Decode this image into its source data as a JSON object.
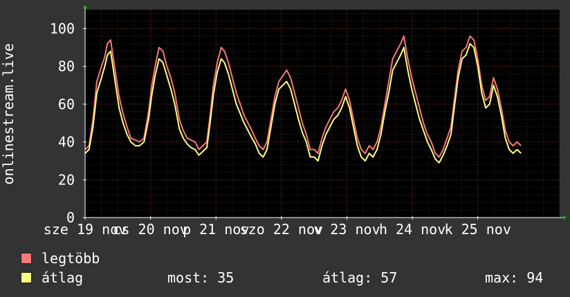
{
  "chart_data": {
    "type": "line",
    "ylabel": "onlinestream.live",
    "ylim": [
      0,
      110
    ],
    "yticks": [
      0,
      20,
      40,
      60,
      80,
      100
    ],
    "xlim": [
      0,
      7.25
    ],
    "xticks": [
      {
        "x": 0,
        "label": "sze 19 nov"
      },
      {
        "x": 1,
        "label": "cs 20 nov"
      },
      {
        "x": 2,
        "label": "p 21 nov"
      },
      {
        "x": 3,
        "label": "szo 22 nov"
      },
      {
        "x": 4,
        "label": "v 23 nov"
      },
      {
        "x": 5,
        "label": "h 24 nov"
      },
      {
        "x": 6,
        "label": "k 25 nov"
      }
    ],
    "grid": true,
    "series": [
      {
        "name": "legtöbb",
        "color": "#f87979",
        "points": [
          [
            0.0,
            36
          ],
          [
            0.06,
            38
          ],
          [
            0.12,
            52
          ],
          [
            0.18,
            72
          ],
          [
            0.25,
            80
          ],
          [
            0.3,
            85
          ],
          [
            0.34,
            92
          ],
          [
            0.39,
            94
          ],
          [
            0.45,
            80
          ],
          [
            0.52,
            64
          ],
          [
            0.58,
            55
          ],
          [
            0.64,
            48
          ],
          [
            0.7,
            42
          ],
          [
            0.77,
            41
          ],
          [
            0.83,
            40
          ],
          [
            0.9,
            42
          ],
          [
            0.97,
            56
          ],
          [
            1.02,
            70
          ],
          [
            1.07,
            80
          ],
          [
            1.13,
            90
          ],
          [
            1.19,
            88
          ],
          [
            1.25,
            80
          ],
          [
            1.31,
            74
          ],
          [
            1.37,
            66
          ],
          [
            1.44,
            52
          ],
          [
            1.5,
            46
          ],
          [
            1.56,
            42
          ],
          [
            1.62,
            41
          ],
          [
            1.68,
            40
          ],
          [
            1.74,
            36
          ],
          [
            1.8,
            38
          ],
          [
            1.86,
            40
          ],
          [
            1.91,
            54
          ],
          [
            1.96,
            70
          ],
          [
            2.02,
            82
          ],
          [
            2.08,
            90
          ],
          [
            2.13,
            88
          ],
          [
            2.19,
            82
          ],
          [
            2.25,
            74
          ],
          [
            2.31,
            66
          ],
          [
            2.37,
            60
          ],
          [
            2.43,
            54
          ],
          [
            2.49,
            50
          ],
          [
            2.55,
            46
          ],
          [
            2.6,
            42
          ],
          [
            2.66,
            38
          ],
          [
            2.72,
            36
          ],
          [
            2.78,
            40
          ],
          [
            2.84,
            52
          ],
          [
            2.9,
            64
          ],
          [
            2.96,
            72
          ],
          [
            3.02,
            75
          ],
          [
            3.08,
            78
          ],
          [
            3.14,
            74
          ],
          [
            3.2,
            66
          ],
          [
            3.26,
            58
          ],
          [
            3.32,
            50
          ],
          [
            3.38,
            44
          ],
          [
            3.44,
            36
          ],
          [
            3.5,
            36
          ],
          [
            3.56,
            34
          ],
          [
            3.62,
            42
          ],
          [
            3.68,
            48
          ],
          [
            3.74,
            52
          ],
          [
            3.8,
            56
          ],
          [
            3.86,
            58
          ],
          [
            3.92,
            62
          ],
          [
            3.98,
            68
          ],
          [
            4.04,
            62
          ],
          [
            4.1,
            52
          ],
          [
            4.16,
            42
          ],
          [
            4.22,
            36
          ],
          [
            4.28,
            34
          ],
          [
            4.34,
            38
          ],
          [
            4.4,
            36
          ],
          [
            4.46,
            40
          ],
          [
            4.52,
            48
          ],
          [
            4.58,
            60
          ],
          [
            4.64,
            72
          ],
          [
            4.7,
            84
          ],
          [
            4.76,
            88
          ],
          [
            4.82,
            92
          ],
          [
            4.87,
            96
          ],
          [
            4.93,
            84
          ],
          [
            4.99,
            74
          ],
          [
            5.05,
            66
          ],
          [
            5.11,
            58
          ],
          [
            5.17,
            50
          ],
          [
            5.23,
            44
          ],
          [
            5.29,
            40
          ],
          [
            5.35,
            34
          ],
          [
            5.41,
            32
          ],
          [
            5.47,
            36
          ],
          [
            5.53,
            42
          ],
          [
            5.59,
            48
          ],
          [
            5.64,
            62
          ],
          [
            5.7,
            78
          ],
          [
            5.76,
            88
          ],
          [
            5.82,
            90
          ],
          [
            5.88,
            96
          ],
          [
            5.94,
            94
          ],
          [
            6.0,
            84
          ],
          [
            6.06,
            70
          ],
          [
            6.12,
            62
          ],
          [
            6.18,
            64
          ],
          [
            6.24,
            74
          ],
          [
            6.3,
            68
          ],
          [
            6.36,
            58
          ],
          [
            6.42,
            46
          ],
          [
            6.48,
            40
          ],
          [
            6.54,
            38
          ],
          [
            6.6,
            40
          ],
          [
            6.66,
            38
          ]
        ]
      },
      {
        "name": "átlag",
        "color": "#ffff80",
        "points": [
          [
            0.0,
            34
          ],
          [
            0.06,
            36
          ],
          [
            0.12,
            48
          ],
          [
            0.18,
            66
          ],
          [
            0.25,
            74
          ],
          [
            0.3,
            80
          ],
          [
            0.34,
            86
          ],
          [
            0.39,
            88
          ],
          [
            0.45,
            74
          ],
          [
            0.52,
            58
          ],
          [
            0.58,
            50
          ],
          [
            0.64,
            44
          ],
          [
            0.7,
            40
          ],
          [
            0.77,
            38
          ],
          [
            0.83,
            38
          ],
          [
            0.9,
            40
          ],
          [
            0.97,
            52
          ],
          [
            1.02,
            65
          ],
          [
            1.07,
            75
          ],
          [
            1.13,
            84
          ],
          [
            1.19,
            82
          ],
          [
            1.25,
            75
          ],
          [
            1.31,
            68
          ],
          [
            1.37,
            60
          ],
          [
            1.44,
            47
          ],
          [
            1.5,
            42
          ],
          [
            1.56,
            39
          ],
          [
            1.62,
            37
          ],
          [
            1.68,
            36
          ],
          [
            1.74,
            33
          ],
          [
            1.8,
            35
          ],
          [
            1.86,
            37
          ],
          [
            1.91,
            50
          ],
          [
            1.96,
            65
          ],
          [
            2.02,
            77
          ],
          [
            2.08,
            84
          ],
          [
            2.13,
            82
          ],
          [
            2.19,
            76
          ],
          [
            2.25,
            68
          ],
          [
            2.31,
            60
          ],
          [
            2.37,
            55
          ],
          [
            2.43,
            50
          ],
          [
            2.49,
            46
          ],
          [
            2.55,
            42
          ],
          [
            2.6,
            39
          ],
          [
            2.66,
            34
          ],
          [
            2.72,
            32
          ],
          [
            2.78,
            36
          ],
          [
            2.84,
            48
          ],
          [
            2.9,
            60
          ],
          [
            2.96,
            68
          ],
          [
            3.02,
            70
          ],
          [
            3.08,
            72
          ],
          [
            3.14,
            68
          ],
          [
            3.2,
            60
          ],
          [
            3.26,
            52
          ],
          [
            3.32,
            45
          ],
          [
            3.38,
            40
          ],
          [
            3.44,
            32
          ],
          [
            3.5,
            32
          ],
          [
            3.56,
            30
          ],
          [
            3.62,
            38
          ],
          [
            3.68,
            44
          ],
          [
            3.74,
            48
          ],
          [
            3.8,
            52
          ],
          [
            3.86,
            54
          ],
          [
            3.92,
            58
          ],
          [
            3.98,
            64
          ],
          [
            4.04,
            58
          ],
          [
            4.1,
            48
          ],
          [
            4.16,
            38
          ],
          [
            4.22,
            32
          ],
          [
            4.28,
            30
          ],
          [
            4.34,
            34
          ],
          [
            4.4,
            32
          ],
          [
            4.46,
            36
          ],
          [
            4.52,
            44
          ],
          [
            4.58,
            56
          ],
          [
            4.64,
            66
          ],
          [
            4.7,
            78
          ],
          [
            4.76,
            82
          ],
          [
            4.82,
            86
          ],
          [
            4.87,
            90
          ],
          [
            4.93,
            78
          ],
          [
            4.99,
            68
          ],
          [
            5.05,
            60
          ],
          [
            5.11,
            52
          ],
          [
            5.17,
            46
          ],
          [
            5.23,
            40
          ],
          [
            5.29,
            36
          ],
          [
            5.35,
            31
          ],
          [
            5.41,
            29
          ],
          [
            5.47,
            33
          ],
          [
            5.53,
            38
          ],
          [
            5.59,
            44
          ],
          [
            5.64,
            58
          ],
          [
            5.7,
            74
          ],
          [
            5.76,
            84
          ],
          [
            5.82,
            86
          ],
          [
            5.88,
            92
          ],
          [
            5.94,
            90
          ],
          [
            6.0,
            80
          ],
          [
            6.06,
            66
          ],
          [
            6.12,
            58
          ],
          [
            6.18,
            60
          ],
          [
            6.24,
            70
          ],
          [
            6.3,
            64
          ],
          [
            6.36,
            54
          ],
          [
            6.42,
            42
          ],
          [
            6.48,
            36
          ],
          [
            6.54,
            34
          ],
          [
            6.6,
            36
          ],
          [
            6.66,
            34
          ]
        ]
      }
    ]
  },
  "legend": [
    {
      "label": "legtöbb",
      "color": "#f87979"
    },
    {
      "label": "átlag",
      "color": "#ffff80"
    }
  ],
  "stats": {
    "most": "most: 35",
    "atlag": "átlag: 57",
    "max": "max: 94"
  }
}
